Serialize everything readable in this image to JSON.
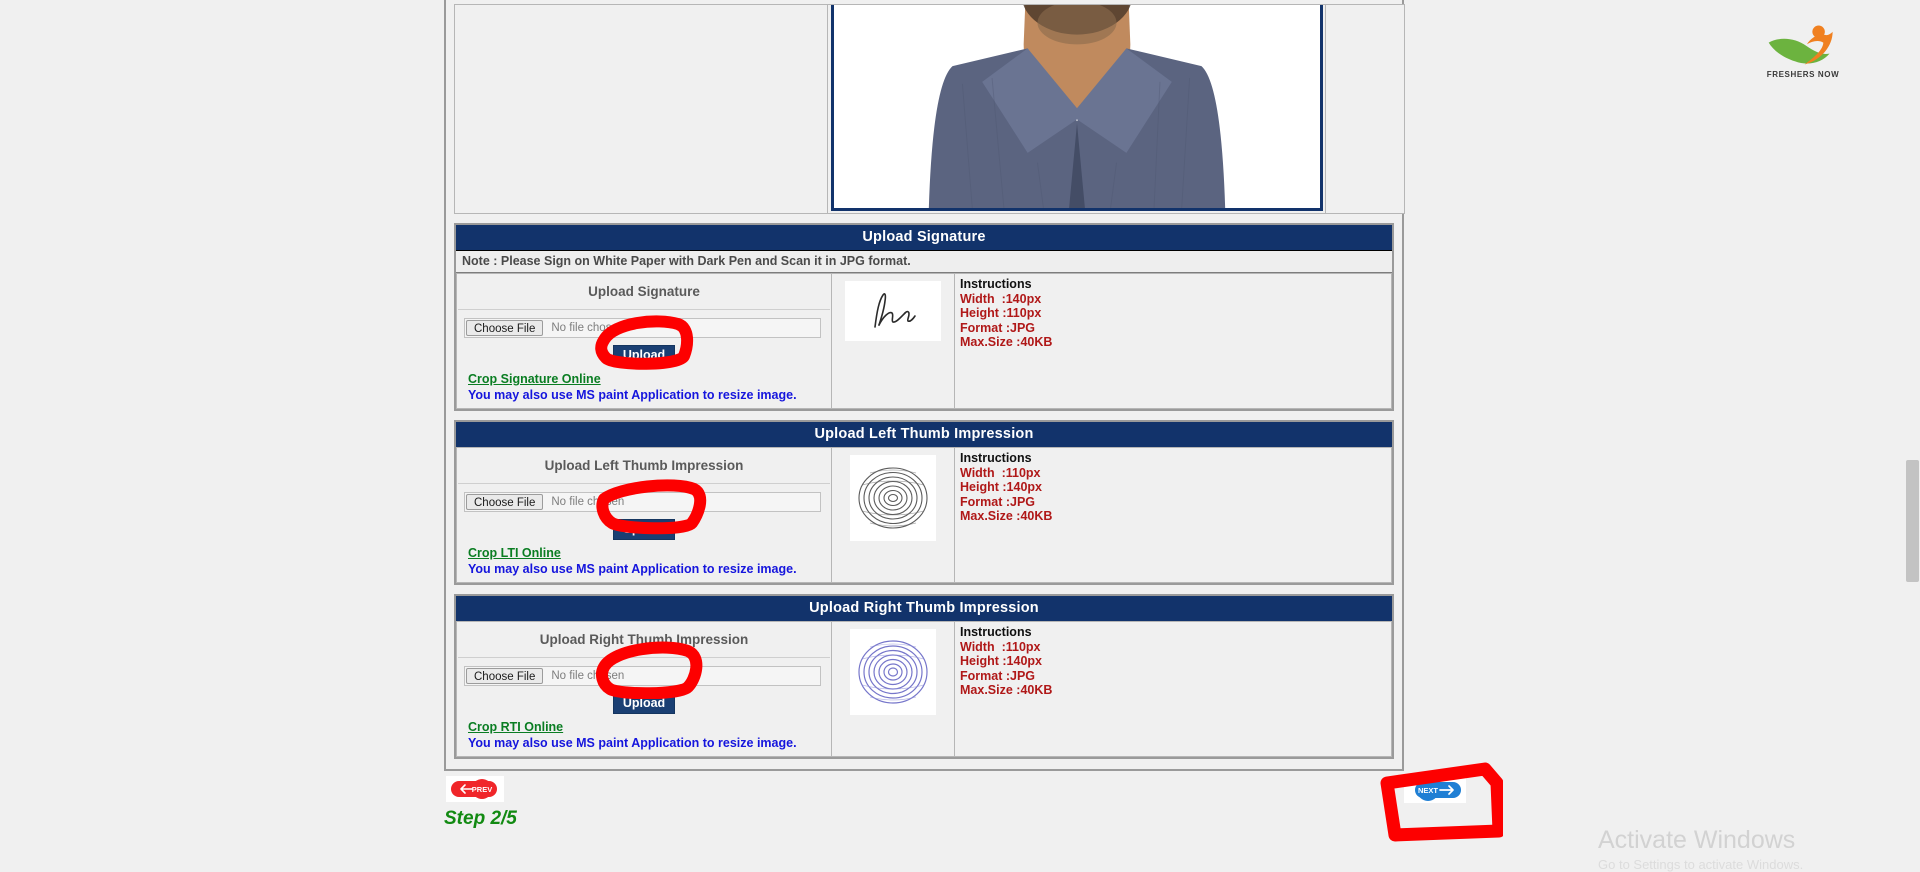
{
  "brand": {
    "logo_text": "FRESHERS NOW",
    "logo_icon": "freshers-now-swoosh-logo",
    "green": "#6cb33f",
    "orange": "#f08020"
  },
  "theme": {
    "header_blue": "#12336b",
    "link_green": "#0a7d22",
    "note_blue": "#1515dd",
    "instr_red": "#b01818",
    "annotation_red": "#fd0000",
    "next_blue": "#1f7fd4",
    "prev_red": "#f0262a",
    "step_green": "#128a12"
  },
  "photo_section": {
    "preview_alt": "candidate-photo-preview"
  },
  "sections": [
    {
      "id": "signature",
      "header": "Upload Signature",
      "note": "Note : Please Sign on White Paper with Dark Pen and Scan it in JPG format.",
      "field_title": "Upload Signature",
      "choose_file_label": "Choose File",
      "file_status": "No file chosen",
      "upload_label": "Upload",
      "crop_link": "Crop Signature Online",
      "paint_note": "You may also use MS paint Application to resize image.",
      "preview_icon": "signature-preview",
      "instructions": {
        "heading": "Instructions",
        "rows": [
          {
            "label": "Width",
            "value": ":140px"
          },
          {
            "label": "Height",
            "value": ":110px"
          },
          {
            "label": "Format",
            "value": ":JPG"
          },
          {
            "label": "Max.Size",
            "value": ":40KB"
          }
        ]
      }
    },
    {
      "id": "left-thumb",
      "header": "Upload Left Thumb Impression",
      "note": null,
      "field_title": "Upload Left Thumb Impression",
      "choose_file_label": "Choose File",
      "file_status": "No file chosen",
      "upload_label": "Upload",
      "crop_link": "Crop LTI Online",
      "paint_note": "You may also use MS paint Application to resize image.",
      "preview_icon": "left-thumb-impression-preview",
      "instructions": {
        "heading": "Instructions",
        "rows": [
          {
            "label": "Width",
            "value": ":110px"
          },
          {
            "label": "Height",
            "value": ":140px"
          },
          {
            "label": "Format",
            "value": ":JPG"
          },
          {
            "label": "Max.Size",
            "value": ":40KB"
          }
        ]
      }
    },
    {
      "id": "right-thumb",
      "header": "Upload Right Thumb Impression",
      "note": null,
      "field_title": "Upload Right Thumb Impression",
      "choose_file_label": "Choose File",
      "file_status": "No file chosen",
      "upload_label": "Upload",
      "crop_link": "Crop RTI Online",
      "paint_note": "You may also use MS paint Application to resize image.",
      "preview_icon": "right-thumb-impression-preview",
      "instructions": {
        "heading": "Instructions",
        "rows": [
          {
            "label": "Width",
            "value": ":110px"
          },
          {
            "label": "Height",
            "value": ":140px"
          },
          {
            "label": "Format",
            "value": ":JPG"
          },
          {
            "label": "Max.Size",
            "value": ":40KB"
          }
        ]
      }
    }
  ],
  "navigation": {
    "prev_label": "PREV",
    "prev_icon": "arrow-left-icon",
    "next_label": "NEXT",
    "next_icon": "arrow-right-icon",
    "step_text": "Step 2/5"
  },
  "watermark": {
    "title": "Activate Windows",
    "subtitle": "Go to Settings to activate Windows."
  }
}
